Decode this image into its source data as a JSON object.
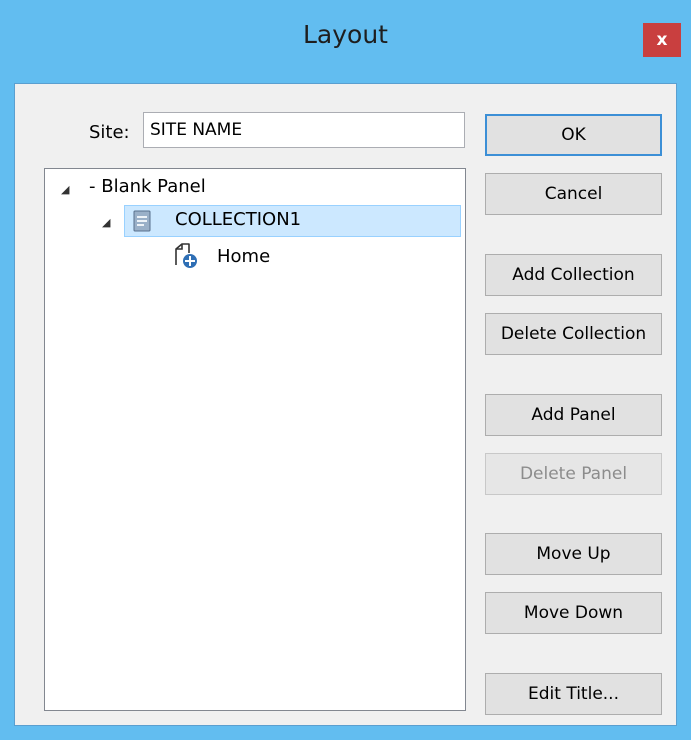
{
  "window": {
    "title": "Layout",
    "close_label": "x"
  },
  "site": {
    "label": "Site:",
    "value": "SITE NAME"
  },
  "tree": {
    "root": {
      "label": "- Blank Panel",
      "expander": "◢"
    },
    "collection": {
      "label": "COLLECTION1",
      "expander": "◢",
      "selected": true
    },
    "page": {
      "label": "Home"
    }
  },
  "buttons": {
    "ok": "OK",
    "cancel": "Cancel",
    "add_collection": "Add Collection",
    "delete_collection": "Delete Collection",
    "add_panel": "Add Panel",
    "delete_panel": "Delete Panel",
    "move_up": "Move Up",
    "move_down": "Move Down",
    "edit_title": "Edit Title..."
  },
  "colors": {
    "titlebar": "#62bdf0",
    "close": "#c93f3f",
    "selection": "#cce8ff",
    "default_button_border": "#3c8fd6"
  },
  "icons": {
    "collection": "collection-icon",
    "home": "home-page-add-icon",
    "expander": "expanded-triangle-icon"
  }
}
